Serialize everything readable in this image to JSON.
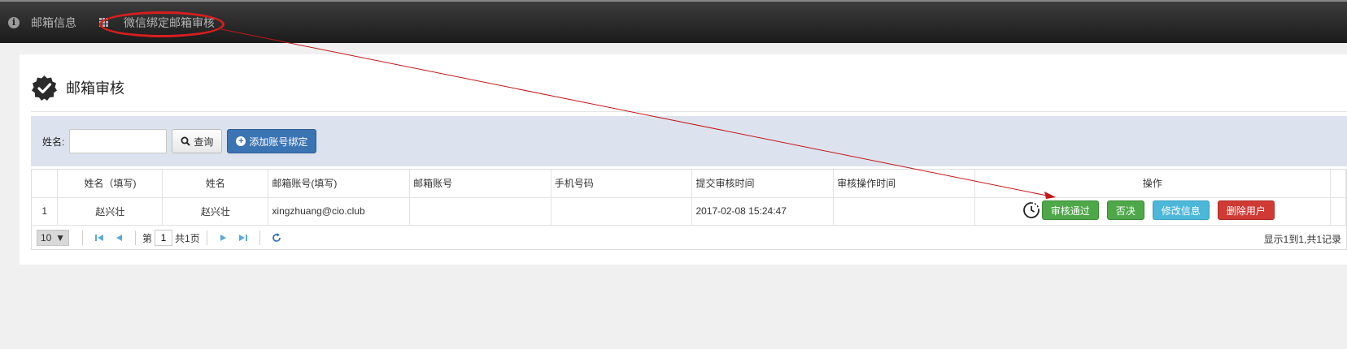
{
  "topbar": {
    "tabs": [
      {
        "label": "邮箱信息",
        "icon": "info-icon"
      },
      {
        "label": "微信绑定邮箱审核",
        "icon": "grid-icon"
      }
    ]
  },
  "page": {
    "title": "邮箱审核",
    "title_icon": "check-badge-icon"
  },
  "search": {
    "name_label": "姓名:",
    "name_value": "",
    "query_button": "查询",
    "add_button": "添加账号绑定"
  },
  "table": {
    "columns": [
      "",
      "姓名（填写)",
      "姓名",
      "邮箱账号(填写)",
      "邮箱账号",
      "手机号码",
      "提交审核时间",
      "审核操作时间",
      "操作"
    ],
    "rows": [
      {
        "index": "1",
        "name_filled": "赵兴壮",
        "name": "赵兴壮",
        "email_filled": "xingzhuang@cio.club",
        "email": "",
        "phone": "",
        "submit_time": "2017-02-08 15:24:47",
        "review_time": "",
        "actions": {
          "status_icon": "clock-icon",
          "approve": "审核通过",
          "reject": "否决",
          "edit": "修改信息",
          "delete": "删除用户"
        }
      }
    ]
  },
  "pager": {
    "page_size": "10",
    "page_prefix": "第",
    "current_page": "1",
    "total_pages": "共1页",
    "summary": "显示1到1,共1记录"
  },
  "annotation": {
    "color": "#d81e1e"
  }
}
